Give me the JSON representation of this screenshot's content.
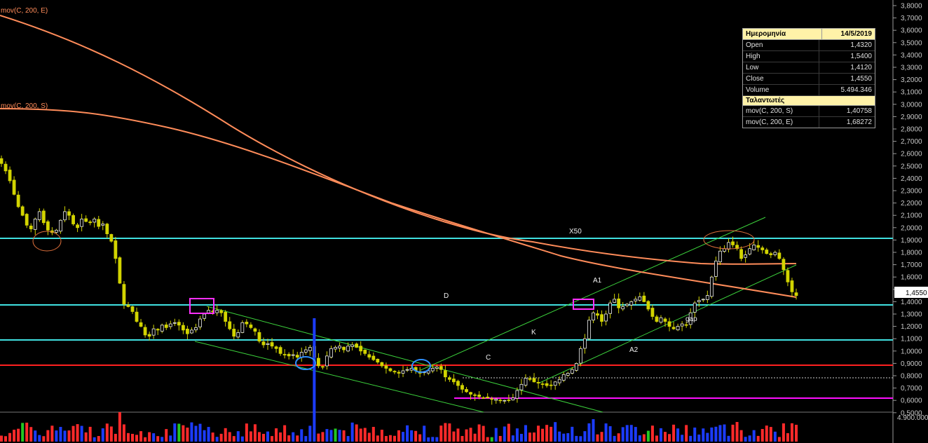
{
  "chart_data": {
    "type": "candlestick",
    "yaxis_ticks": [
      "3,8000",
      "3,7000",
      "3,6000",
      "3,5000",
      "3,4000",
      "3,3000",
      "3,2000",
      "3,1000",
      "3,0000",
      "2,9000",
      "2,8000",
      "2,7000",
      "2,6000",
      "2,5000",
      "2,4000",
      "2,3000",
      "2,2000",
      "2,1000",
      "2,0000",
      "1,9000",
      "1,8000",
      "1,7000",
      "1,6000",
      "1,5000",
      "1,4000",
      "1,3000",
      "1,2000",
      "1,1000",
      "1,0000",
      "0,9000",
      "0,8000",
      "0,7000",
      "0,6000",
      "0,5000"
    ],
    "yaxis_values": [
      3.8,
      3.7,
      3.6,
      3.5,
      3.4,
      3.3,
      3.2,
      3.1,
      3.0,
      2.9,
      2.8,
      2.7,
      2.6,
      2.5,
      2.4,
      2.3,
      2.2,
      2.1,
      2.0,
      1.9,
      1.8,
      1.7,
      1.6,
      1.5,
      1.4,
      1.3,
      1.2,
      1.1,
      1.0,
      0.9,
      0.8,
      0.7,
      0.6,
      0.5
    ],
    "ylim": [
      0.48,
      3.82
    ],
    "last_price_label": "1,4550",
    "volume_axis_label": "4.900.000",
    "indicator_labels": {
      "ema": "mov(C, 200, E)",
      "sma": "mov(C, 200, S)"
    },
    "close_series": [
      2.52,
      2.46,
      2.38,
      2.27,
      2.17,
      2.1,
      2.02,
      1.99,
      2.07,
      2.13,
      2.04,
      1.98,
      1.96,
      1.98,
      2.06,
      2.13,
      2.1,
      2.03,
      2.0,
      2.07,
      2.05,
      2.04,
      2.07,
      2.01,
      2.03,
      1.95,
      1.89,
      1.75,
      1.55,
      1.38,
      1.36,
      1.32,
      1.24,
      1.2,
      1.13,
      1.12,
      1.18,
      1.17,
      1.21,
      1.19,
      1.22,
      1.23,
      1.21,
      1.17,
      1.14,
      1.17,
      1.19,
      1.26,
      1.3,
      1.33,
      1.32,
      1.33,
      1.31,
      1.24,
      1.18,
      1.12,
      1.15,
      1.23,
      1.22,
      1.19,
      1.16,
      1.08,
      1.05,
      1.06,
      1.04,
      1.02,
      0.98,
      0.97,
      0.96,
      0.97,
      0.95,
      0.99,
      1.01,
      1.03,
      0.95,
      0.88,
      0.87,
      0.96,
      1.02,
      1.03,
      1.04,
      1.01,
      1.04,
      1.05,
      1.03,
      1.0,
      0.98,
      0.95,
      0.93,
      0.91,
      0.88,
      0.86,
      0.84,
      0.83,
      0.82,
      0.84,
      0.85,
      0.86,
      0.84,
      0.82,
      0.83,
      0.84,
      0.86,
      0.87,
      0.85,
      0.79,
      0.77,
      0.75,
      0.72,
      0.69,
      0.67,
      0.65,
      0.64,
      0.63,
      0.62,
      0.62,
      0.61,
      0.61,
      0.6,
      0.6,
      0.6,
      0.62,
      0.68,
      0.73,
      0.78,
      0.77,
      0.75,
      0.74,
      0.73,
      0.72,
      0.72,
      0.75,
      0.77,
      0.81,
      0.82,
      0.85,
      0.9,
      1.02,
      1.1,
      1.25,
      1.31,
      1.29,
      1.24,
      1.3,
      1.39,
      1.42,
      1.35,
      1.36,
      1.38,
      1.4,
      1.42,
      1.44,
      1.4,
      1.34,
      1.28,
      1.24,
      1.27,
      1.24,
      1.2,
      1.18,
      1.2,
      1.22,
      1.21,
      1.31,
      1.39,
      1.41,
      1.42,
      1.45,
      1.6,
      1.73,
      1.81,
      1.83,
      1.88,
      1.86,
      1.83,
      1.75,
      1.78,
      1.83,
      1.86,
      1.84,
      1.82,
      1.79,
      1.78,
      1.8,
      1.75,
      1.66,
      1.56,
      1.48,
      1.45
    ]
  },
  "annotations": {
    "x50": "X50",
    "d": "D",
    "c": "C",
    "k": "K",
    "a1": "A1",
    "a2": "A2",
    "gap": "gap"
  },
  "colors": {
    "background": "#000000",
    "candle_up": "#ffffff",
    "candle_down": "#d2d400",
    "cyan_level": "#40e0e0",
    "red_level": "#ff2020",
    "magenta_level": "#ff10ff",
    "channel": "#3cd23c",
    "moving_average": "#ff8c5a",
    "volume_up": "#1c3cff",
    "volume_down": "#ff2a2a",
    "volume_green": "#22c822"
  },
  "infobox": {
    "date_label": "Ημερομηνία",
    "date_value": "14/5/2019",
    "rows": [
      {
        "k": "Open",
        "v": "1,4320"
      },
      {
        "k": "High",
        "v": "1,5400"
      },
      {
        "k": "Low",
        "v": "1,4120"
      },
      {
        "k": "Close",
        "v": "1,4550"
      },
      {
        "k": "Volume",
        "v": "5.494.346"
      }
    ],
    "section_label": "Ταλαντωτές",
    "indicators": [
      {
        "k": "mov(C, 200, S)",
        "v": "1,40758"
      },
      {
        "k": "mov(C, 200, E)",
        "v": "1,68272"
      }
    ]
  }
}
